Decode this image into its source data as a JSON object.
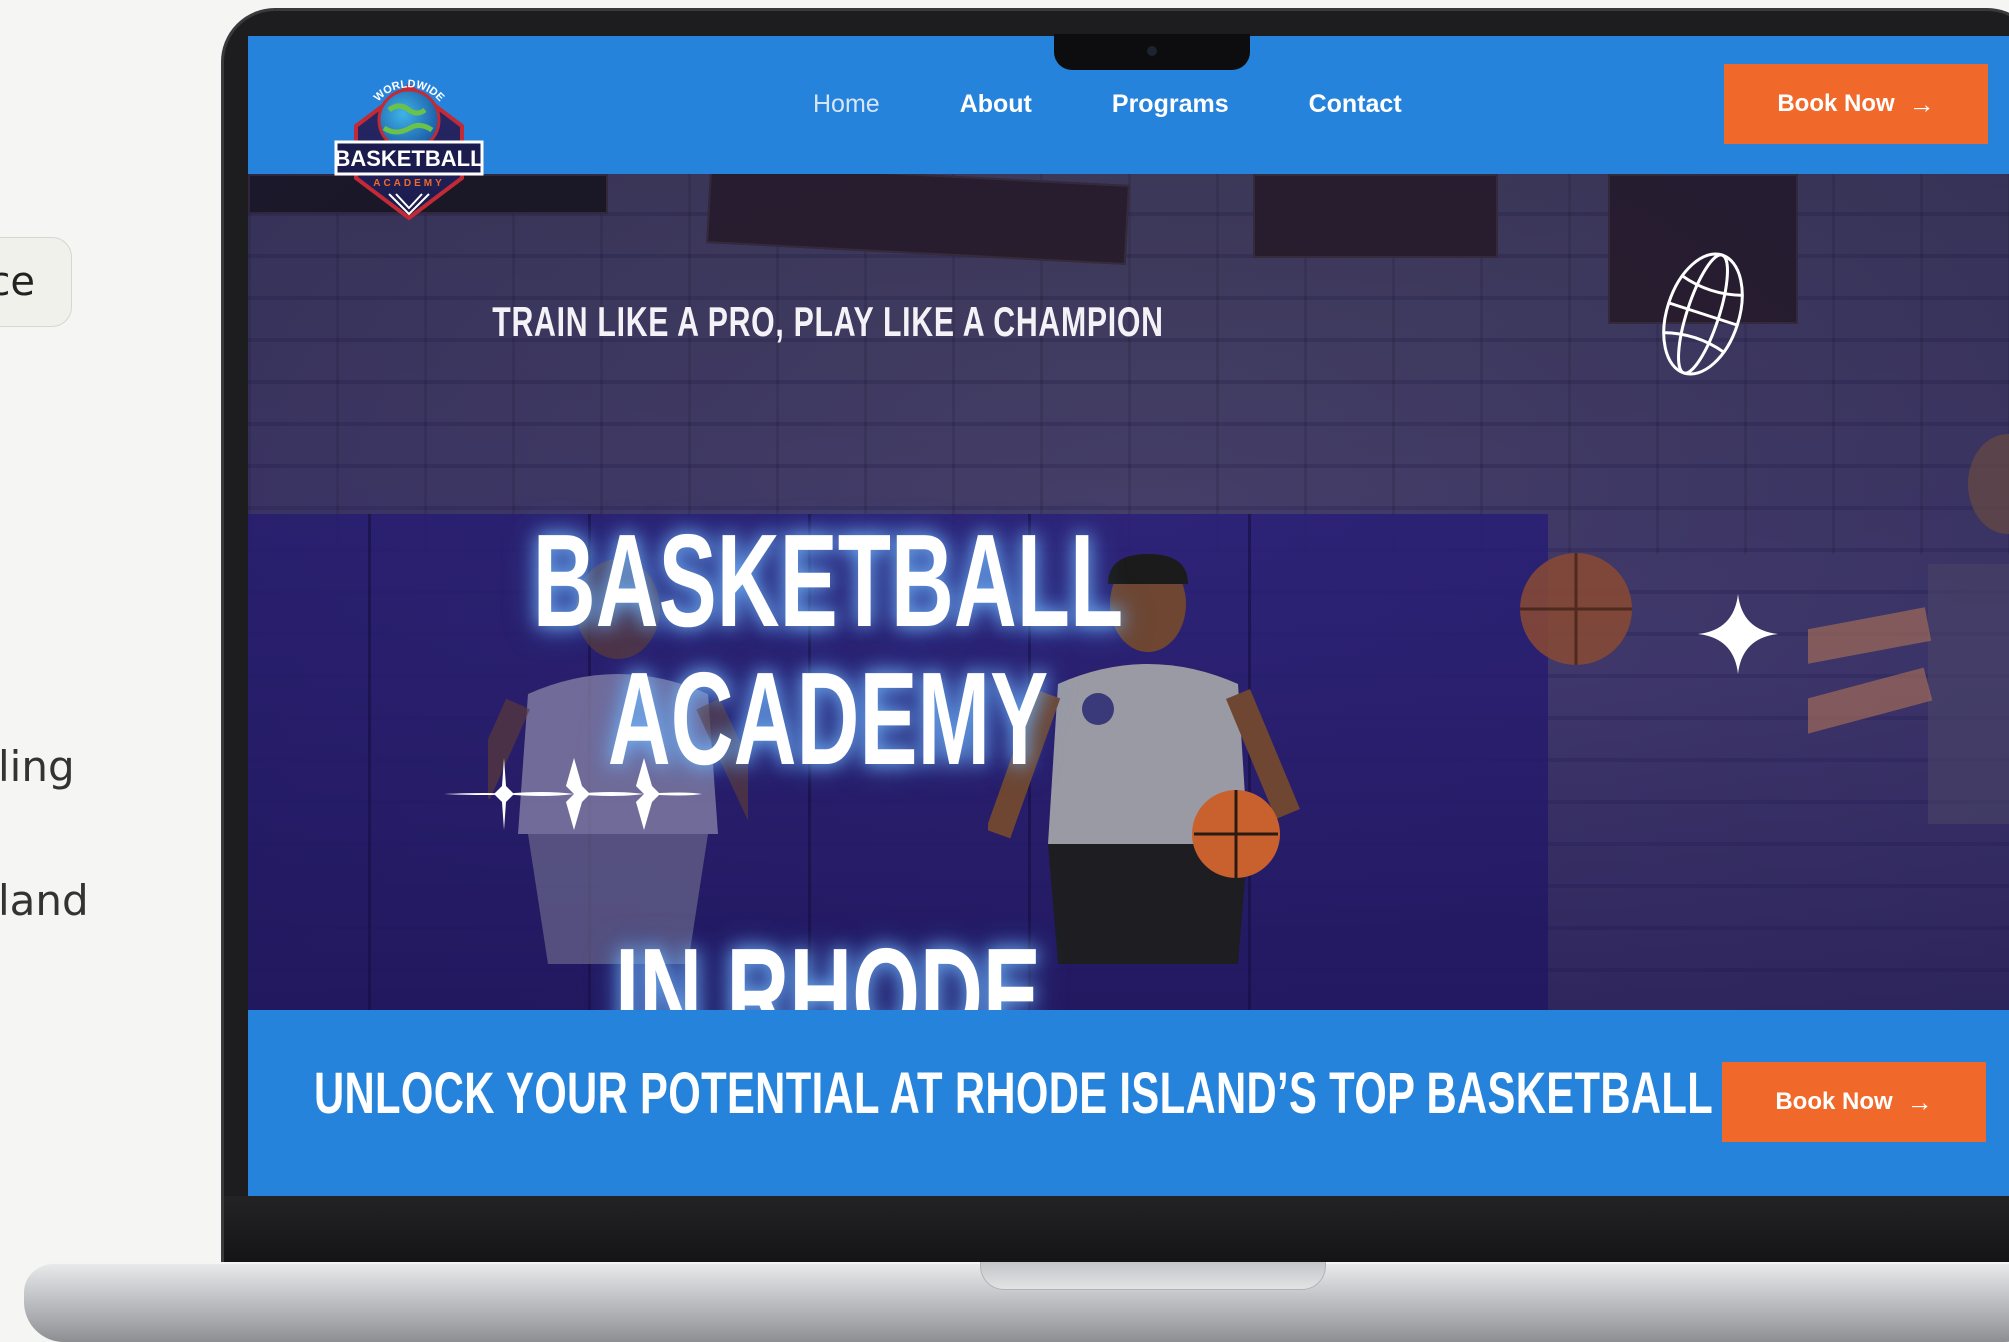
{
  "left_fragments": {
    "pill_text": "ce",
    "text_1": "ling",
    "text_2": "land"
  },
  "site": {
    "logo": {
      "top_text": "WORLDWIDE",
      "main_text": "BASKETBALL",
      "sub_text": "ACADEMY"
    },
    "nav": {
      "items": [
        {
          "label": "Home",
          "active": true
        },
        {
          "label": "About",
          "active": false
        },
        {
          "label": "Programs",
          "active": false
        },
        {
          "label": "Contact",
          "active": false
        }
      ],
      "cta_label": "Book Now",
      "cta_arrow": "→"
    },
    "hero": {
      "tagline": "TRAIN LIKE A PRO, PLAY LIKE A CHAMPION",
      "title_line1": "BASKETBALL ACADEMY",
      "title_line2": "IN RHODE ISLAND"
    },
    "cta_band": {
      "text": "UNLOCK YOUR POTENTIAL AT RHODE ISLAND’S TOP BASKETBALL ACADEMY",
      "button_label": "Book Now",
      "button_arrow": "→"
    },
    "colors": {
      "primary_blue": "#2683db",
      "accent_orange": "#f0692a",
      "hero_purple": "#2a1f7a"
    }
  }
}
